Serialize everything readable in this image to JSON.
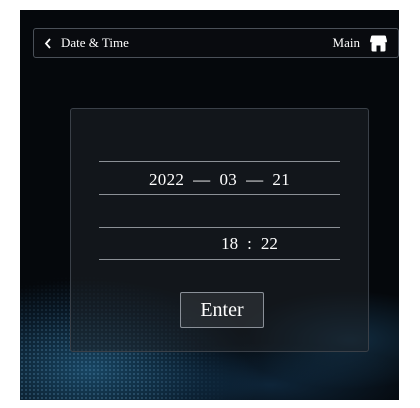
{
  "header": {
    "back_label": "Date & Time",
    "main_label": "Main",
    "back_icon": "chevron-left-icon",
    "home_icon": "home-icon"
  },
  "date": {
    "year": "2022",
    "month": "03",
    "day": "21",
    "separator": "—"
  },
  "time": {
    "hour": "18",
    "minute": "22",
    "separator": ":"
  },
  "enter_label": "Enter",
  "colors": {
    "background": "#05080c",
    "text": "#ffffff",
    "accent_glow": "#2878aa"
  }
}
